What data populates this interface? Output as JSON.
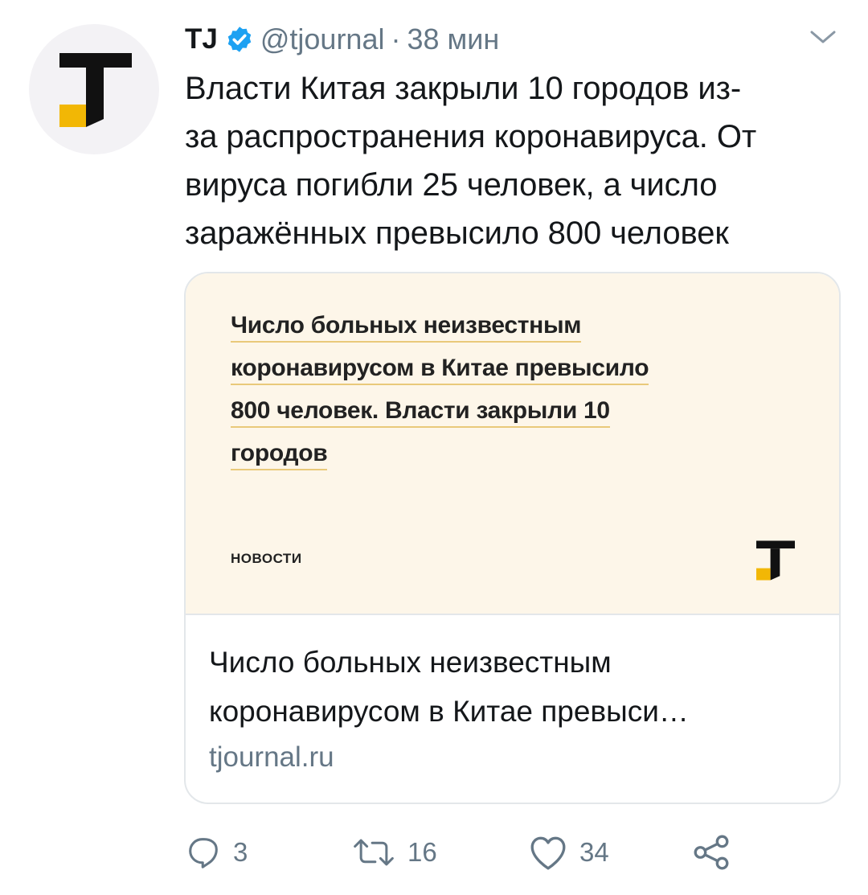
{
  "tweet": {
    "author_name": "TJ",
    "verified": true,
    "handle": "@tjournal",
    "separator": "·",
    "time": "38 мин",
    "lines": [
      "Власти Китая закрыли 10 городов из-",
      "за распространения коронавируса. От",
      "вируса погибли 25 человек, а число",
      "заражённых превысило 800 человек"
    ]
  },
  "card": {
    "image_title_lines": [
      "Число больных неизвестным",
      "коронавирусом в Китае превысило",
      "800 человек. Власти закрыли 10",
      "городов"
    ],
    "image_label": "НОВОСТИ",
    "title_lines": [
      "Число больных неизвестным",
      "коронавирусом в Китае превыси…"
    ],
    "domain": "tjournal.ru"
  },
  "actions": {
    "replies": "3",
    "retweets": "16",
    "likes": "34"
  },
  "colors": {
    "text": "#14171a",
    "secondary": "#657786",
    "verified_blue": "#1da1f2",
    "logo_yellow": "#f2b705",
    "card_bg": "#fdf6e9",
    "border": "#e3e7ea"
  },
  "icons": [
    "tj-logo-icon",
    "verified-badge-icon",
    "chevron-down-icon",
    "reply-icon",
    "retweet-icon",
    "like-icon",
    "share-icon"
  ]
}
